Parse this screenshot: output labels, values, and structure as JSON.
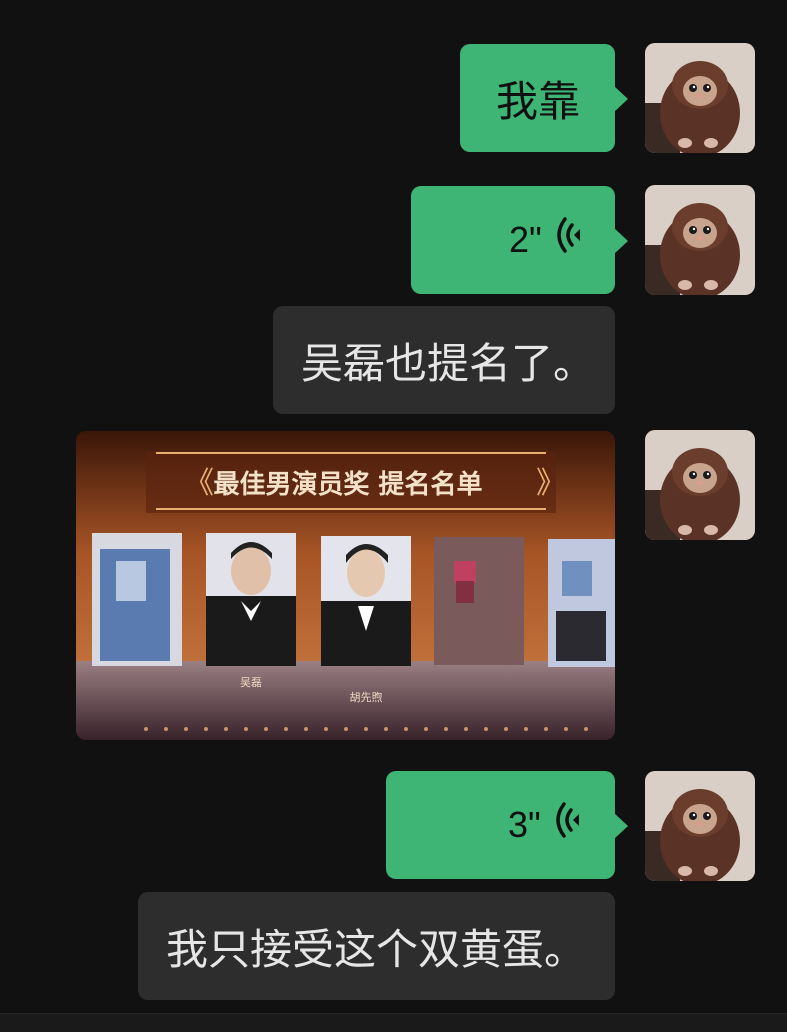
{
  "messages": [
    {
      "type": "text",
      "side": "right",
      "text": "我靠"
    },
    {
      "type": "voice",
      "side": "right",
      "duration": "2\""
    },
    {
      "type": "text",
      "side": "right",
      "text": "吴磊也提名了。"
    },
    {
      "type": "image",
      "side": "right",
      "image": {
        "banner": "最佳男演员奖  提名名单",
        "nominees": [
          {
            "name": "",
            "blurred": true
          },
          {
            "name": "吴磊",
            "blurred": false
          },
          {
            "name": "胡先煦",
            "blurred": false
          },
          {
            "name": "",
            "blurred": true
          },
          {
            "name": "",
            "blurred": true
          }
        ]
      }
    },
    {
      "type": "voice",
      "side": "right",
      "duration": "3\""
    },
    {
      "type": "text",
      "side": "right",
      "text": "我只接受这个双黄蛋。"
    }
  ],
  "colors": {
    "background": "#111111",
    "sent_bubble": "#3eb575",
    "text_bubble": "#2d2d2d"
  },
  "icons": {
    "voice": "voice-wave-icon",
    "avatar": "cat-avatar"
  }
}
